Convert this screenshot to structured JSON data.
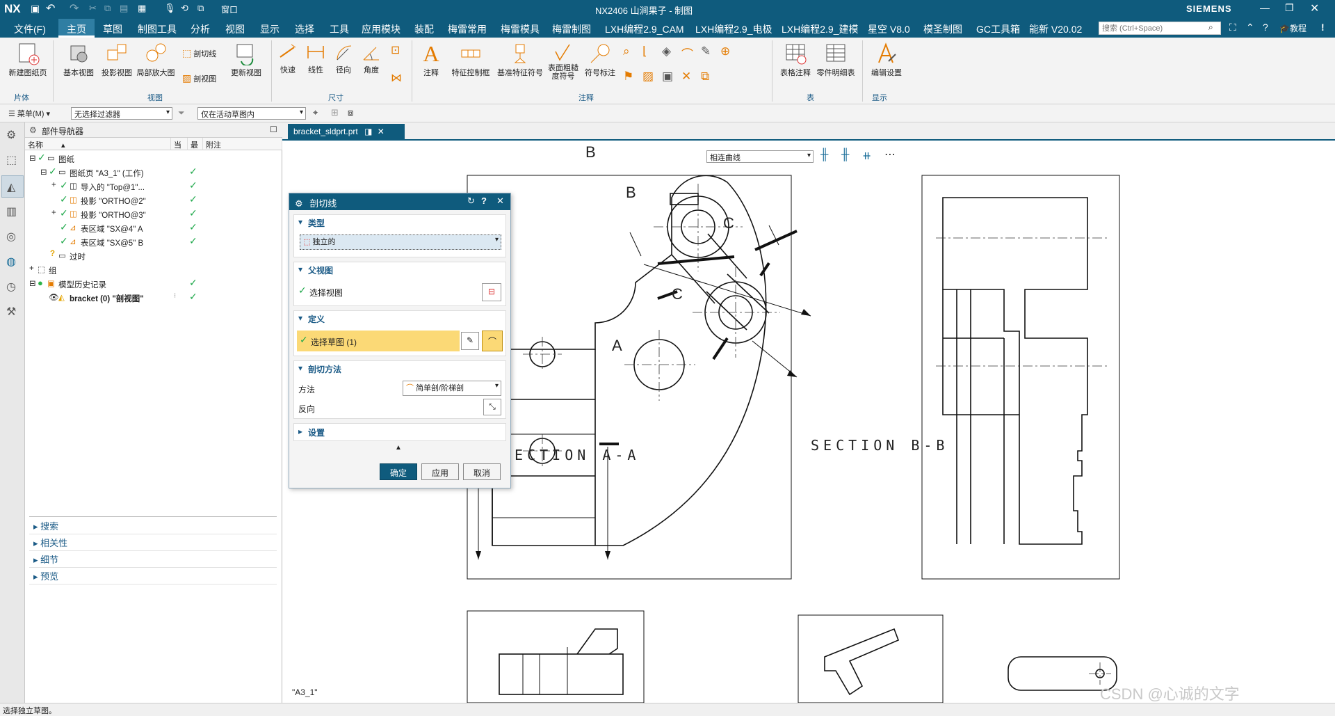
{
  "titlebar": {
    "app_logo": "NX",
    "title": "NX2406 山涧果子 - 制图",
    "brand": "SIEMENS",
    "window_menu": "窗口"
  },
  "menubar": {
    "items": [
      "文件(F)",
      "主页",
      "草图",
      "制图工具",
      "分析",
      "视图",
      "显示",
      "选择",
      "工具",
      "应用模块",
      "装配",
      "梅雷常用",
      "梅雷模具",
      "梅雷制图",
      "LXH编程2.9_CAM",
      "LXH编程2.9_电极",
      "LXH编程2.9_建模",
      "星空 V8.0",
      "模圣制图",
      "GC工具箱",
      "能新 V20.02"
    ],
    "active": "主页",
    "search_placeholder": "搜索 (Ctrl+Space)",
    "tutorial": "教程"
  },
  "ribbon": {
    "new_sheet": "新建图纸页",
    "base_view": "基本视图",
    "projected_view": "投影视图",
    "detail_view": "局部放大图",
    "section_line": "剖切线",
    "section_view": "剖视图",
    "update_view": "更新视图",
    "quick": "快速",
    "linear": "线性",
    "radial": "径向",
    "angular": "角度",
    "note": "注释",
    "fcf": "特征控制框",
    "datum": "基准特征符号",
    "surface_finish": "表面粗糙度符号",
    "symbol_label": "符号标注",
    "table_note": "表格注释",
    "parts_list": "零件明细表",
    "edit_settings": "编辑设置",
    "groups": {
      "sheet": "片体",
      "view": "视图",
      "dimension": "尺寸",
      "annotation": "注释",
      "table": "表",
      "display": "显示"
    }
  },
  "filterbar": {
    "menu": "菜单(M)",
    "selection_filter": "无选择过滤器",
    "scope": "仅在活动草图内"
  },
  "navigator": {
    "title": "部件导航器",
    "columns": [
      "名称",
      "当",
      "最",
      "附注"
    ],
    "rows": [
      {
        "label": "图纸",
        "indent": 0,
        "check": false
      },
      {
        "label": "图纸页 \"A3_1\" (工作)",
        "indent": 1,
        "check": true
      },
      {
        "label": "导入的 \"Top@1\"...",
        "indent": 2,
        "check": true
      },
      {
        "label": "投影 \"ORTHO@2\"",
        "indent": 2,
        "check": true
      },
      {
        "label": "投影 \"ORTHO@3\"",
        "indent": 2,
        "check": true
      },
      {
        "label": "表区域 \"SX@4\" A",
        "indent": 2,
        "check": true
      },
      {
        "label": "表区域 \"SX@5\" B",
        "indent": 2,
        "check": true
      },
      {
        "label": "过时",
        "indent": 1,
        "check": false
      },
      {
        "label": "组",
        "indent": 0,
        "check": false
      },
      {
        "label": "模型历史记录",
        "indent": 0,
        "check": true
      },
      {
        "label": "bracket (0) \"剖视图\"",
        "indent": 1,
        "check": true
      }
    ],
    "sections": [
      "搜索",
      "相关性",
      "细节",
      "预览"
    ]
  },
  "doc_tab": "bracket_sldprt.prt",
  "canvas_toolbar": {
    "curve_rule": "相连曲线"
  },
  "dialog": {
    "title": "剖切线",
    "type_header": "类型",
    "type_value": "独立的",
    "parent_header": "父视图",
    "parent_label": "选择视图",
    "define_header": "定义",
    "define_label": "选择草图 (1)",
    "method_header": "剖切方法",
    "method_label": "方法",
    "method_value": "简单剖/阶梯剖",
    "reverse_label": "反向",
    "settings_header": "设置",
    "ok": "确定",
    "apply": "应用",
    "cancel": "取消"
  },
  "drawing": {
    "label_a": "A",
    "label_b": "B",
    "label_c": "C",
    "section_aa": "SECTION A-A",
    "section_bb": "SECTION B-B",
    "sheet_name": "\"A3_1\""
  },
  "watermark": "CSDN @心诚的文字",
  "status": "选择独立草图。"
}
